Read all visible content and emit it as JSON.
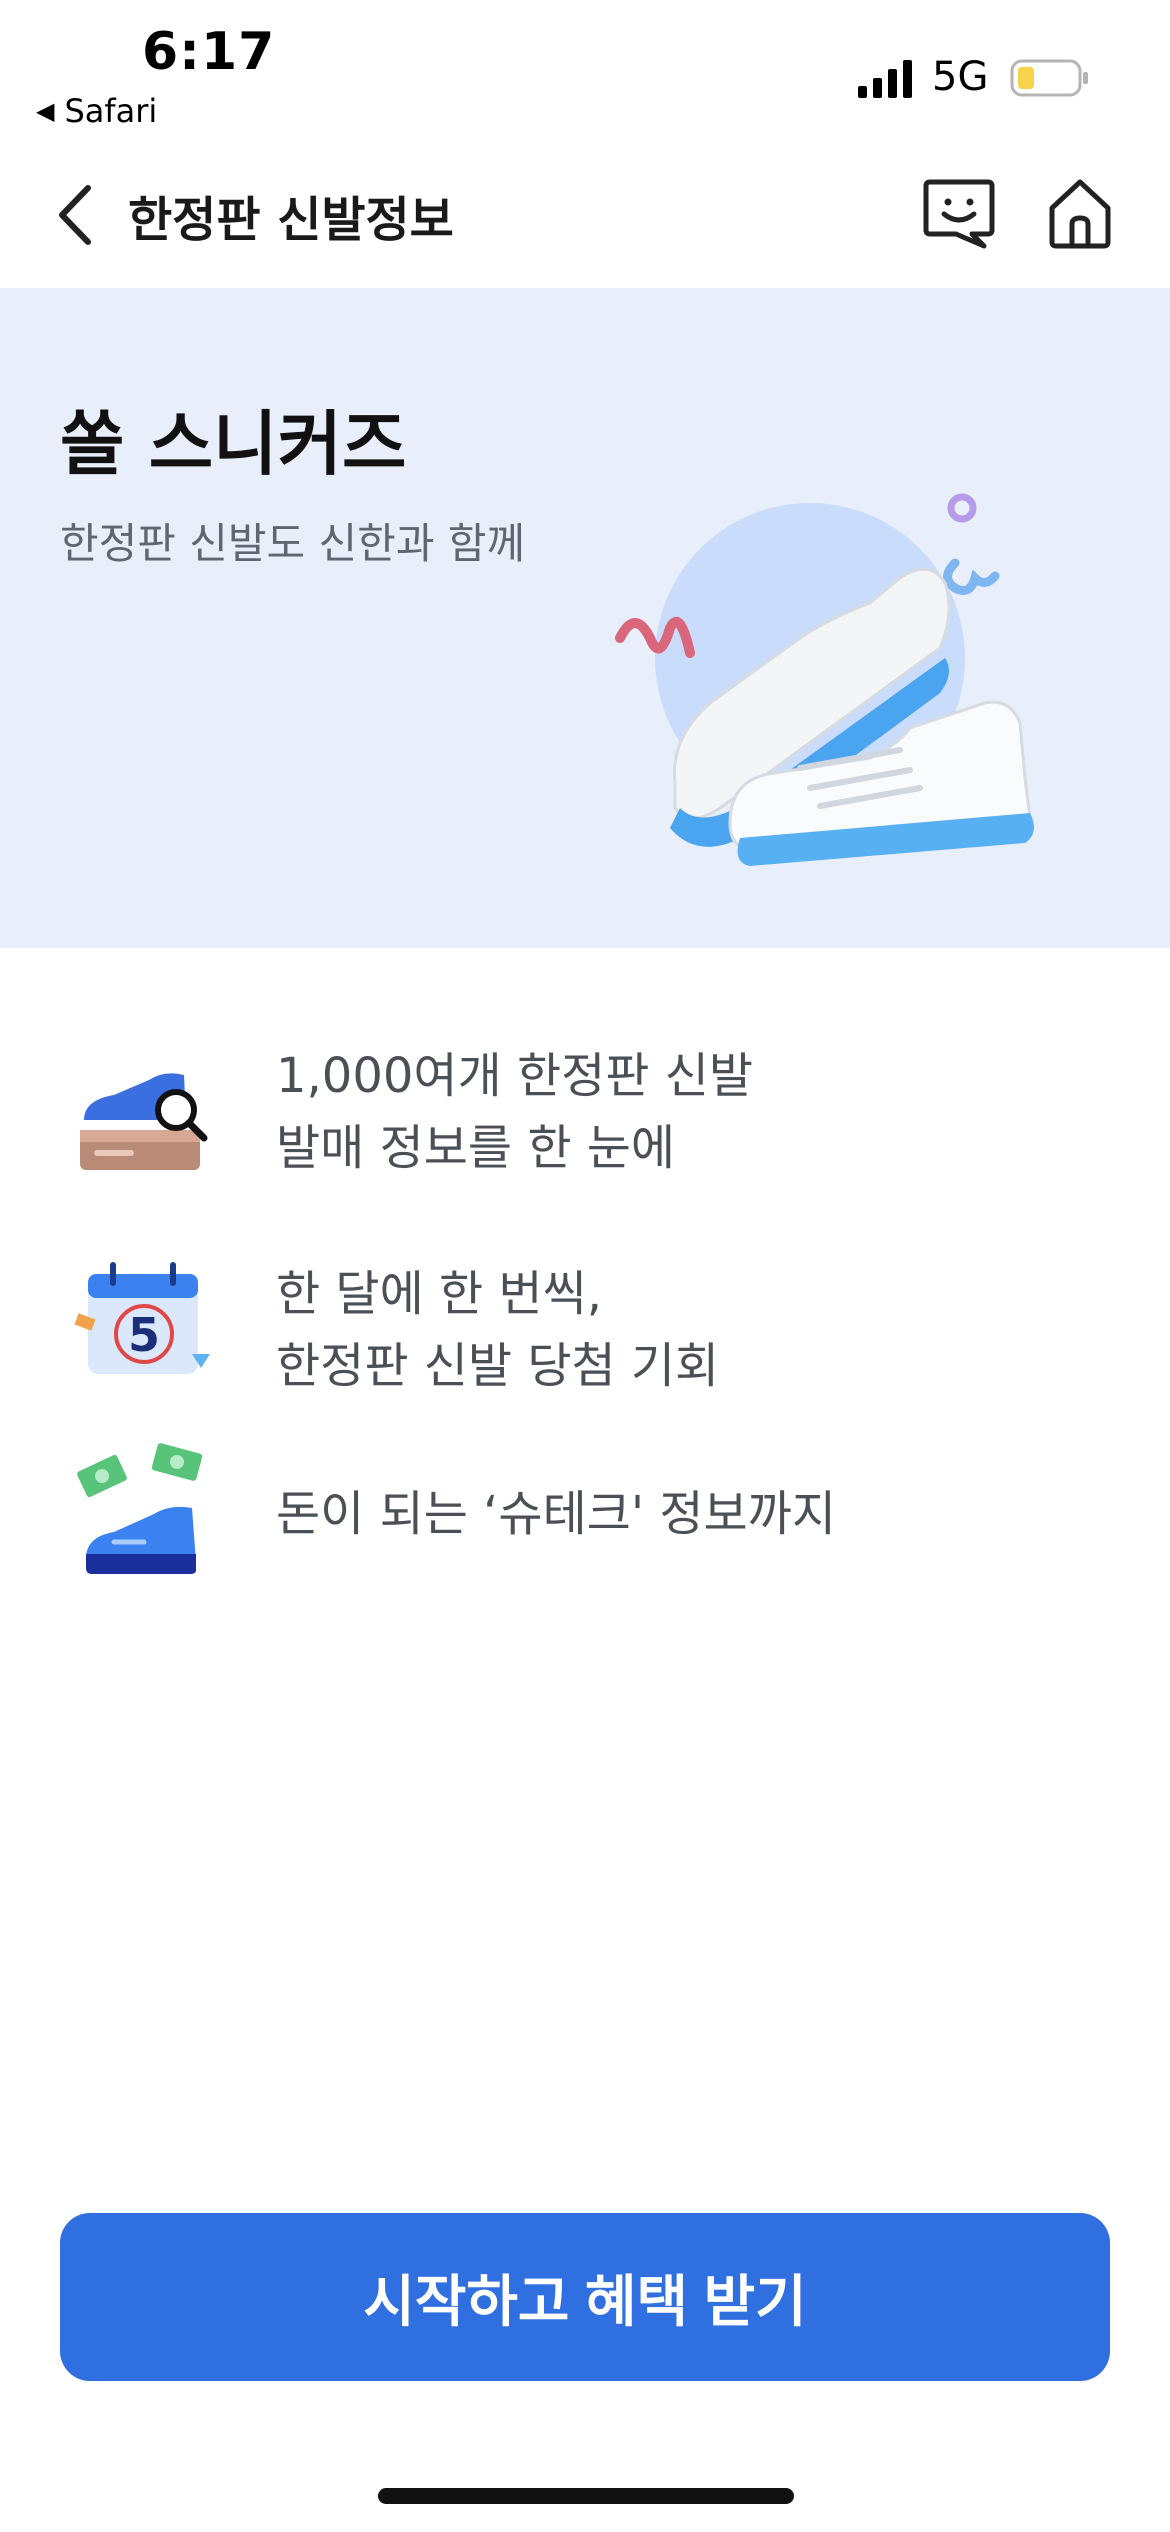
{
  "status_bar": {
    "time": "6:17",
    "back_app": "Safari",
    "network": "5G",
    "battery_color": "#f7d24b"
  },
  "nav": {
    "title": "한정판 신발정보"
  },
  "hero": {
    "title": "쏠 스니커즈",
    "subtitle": "한정판 신발도 신한과 함께",
    "background": "#e8effa"
  },
  "features": [
    {
      "icon": "sneaker-search-icon",
      "text": "1,000여개 한정판 신발\n발매 정보를 한 눈에"
    },
    {
      "icon": "calendar-5-icon",
      "text": "한 달에 한 번씩,\n한정판 신발 당첨 기회"
    },
    {
      "icon": "sneaker-money-icon",
      "text": "돈이 되는 ‘슈테크' 정보까지"
    }
  ],
  "cta": {
    "label": "시작하고 혜택 받기",
    "color": "#2f6fe0"
  }
}
